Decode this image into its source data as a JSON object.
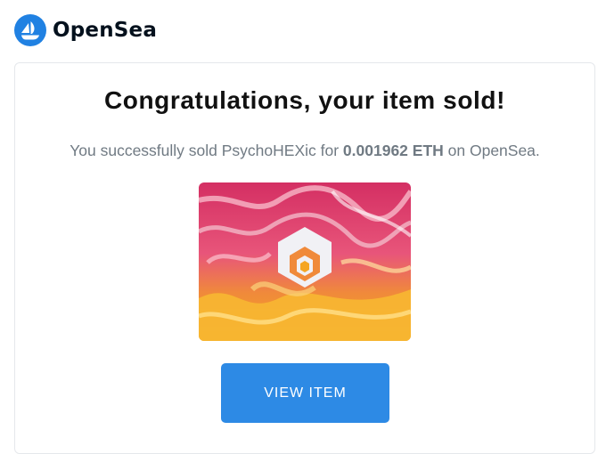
{
  "brand": {
    "name": "OpenSea",
    "logo_icon": "opensea-boat-icon",
    "accent": "#2081e2"
  },
  "email": {
    "title": "Congratulations, your item sold!",
    "subtitle_prefix": "You successfully sold PsychoHEXic for ",
    "price": "0.001962 ETH",
    "subtitle_suffix": " on OpenSea.",
    "item_image_icon": "hex-logo-artwork",
    "cta_label": "VIEW ITEM",
    "cta_color": "#2d8ae5"
  }
}
